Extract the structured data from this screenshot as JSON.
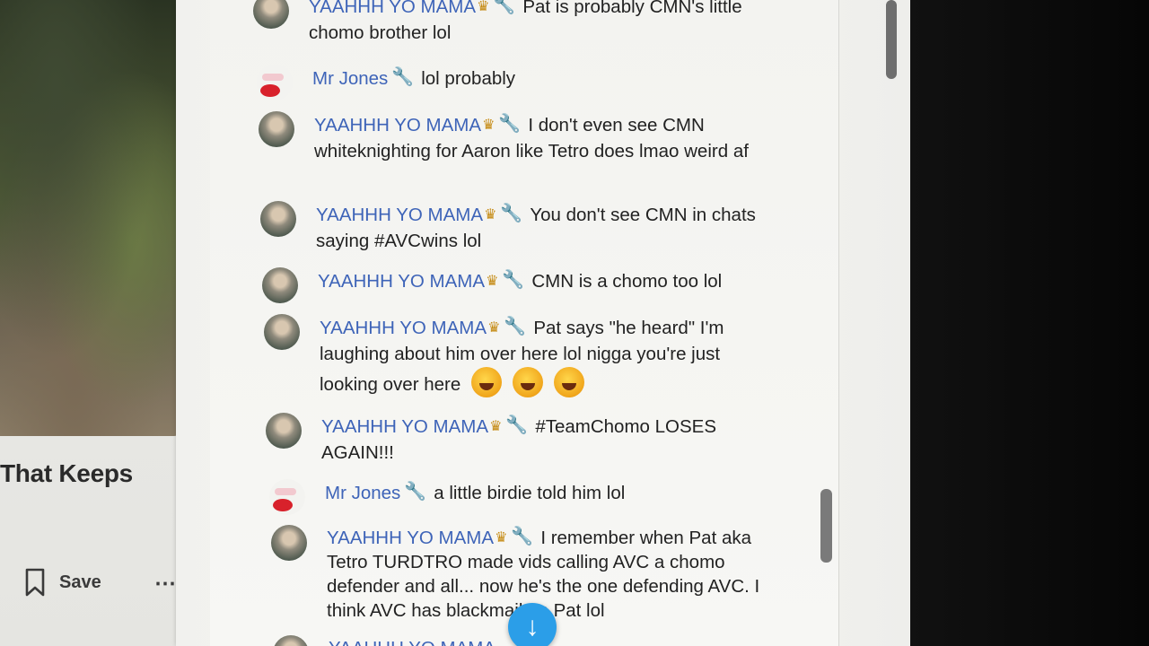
{
  "video": {
    "title_fragment": "That Keeps",
    "save_label": "Save",
    "more_icon": "⋯"
  },
  "chat": {
    "messages": [
      {
        "author": "YAAHHH YO MAMA",
        "badges": [
          "crown",
          "wrench"
        ],
        "text": "Pat is probably CMN's little chomo brother lol"
      },
      {
        "author": "Mr Jones",
        "badges": [
          "wrench"
        ],
        "text": "lol probably"
      },
      {
        "author": "YAAHHH YO MAMA",
        "badges": [
          "crown",
          "wrench"
        ],
        "text": "I don't even see CMN whiteknighting for Aaron like Tetro does lmao weird af"
      },
      {
        "author": "YAAHHH YO MAMA",
        "badges": [
          "crown",
          "wrench"
        ],
        "text": "You don't see CMN in chats saying #AVCwins lol"
      },
      {
        "author": "YAAHHH YO MAMA",
        "badges": [
          "crown",
          "wrench"
        ],
        "text": "CMN is a chomo too lol"
      },
      {
        "author": "YAAHHH YO MAMA",
        "badges": [
          "crown",
          "wrench"
        ],
        "text": "Pat says \"he heard\" I'm laughing about him over here lol nigga you're just looking over here",
        "emojis": 3
      },
      {
        "author": "YAAHHH YO MAMA",
        "badges": [
          "crown",
          "wrench"
        ],
        "text": "#TeamChomo LOSES AGAIN!!!"
      },
      {
        "author": "Mr Jones",
        "badges": [
          "wrench"
        ],
        "text": "a little birdie told him lol"
      },
      {
        "author": "YAAHHH YO MAMA",
        "badges": [
          "crown",
          "wrench"
        ],
        "text": "I remember when Pat aka Tetro TURDTRO made vids calling AVC a chomo defender and all... now he's the one defending AVC. I think AVC has blackmail on Pat lol"
      },
      {
        "author": "YAAHHH YO MAMA",
        "badges": [
          "crown",
          "wrench"
        ],
        "text": ""
      }
    ],
    "scroll_down_icon": "↓"
  },
  "icons": {
    "crown": "crown-icon",
    "wrench": "wrench-icon",
    "bookmark": "bookmark-icon",
    "arrow_down": "arrow-down-icon"
  },
  "colors": {
    "author": "#3e64b8",
    "scroll_button": "#2b9ee8",
    "crown": "#c58a12"
  }
}
